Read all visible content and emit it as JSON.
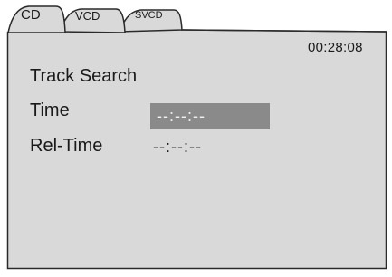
{
  "tabs": [
    {
      "label": "CD"
    },
    {
      "label": "VCD"
    },
    {
      "label": "SVCD"
    }
  ],
  "status": {
    "time": "00:28:08"
  },
  "panel": {
    "title": "Track Search"
  },
  "fields": {
    "time_label": "Time",
    "time_value": "--:--:--",
    "rel_time_label": "Rel-Time",
    "rel_time_value": "--:--:--"
  },
  "colors": {
    "panel_background": "#d9d9d9",
    "tab_background": "#d9d9d9",
    "border": "#2a2a2a",
    "highlight_field": "#8a8a8a",
    "text": "#1a1a1a"
  }
}
